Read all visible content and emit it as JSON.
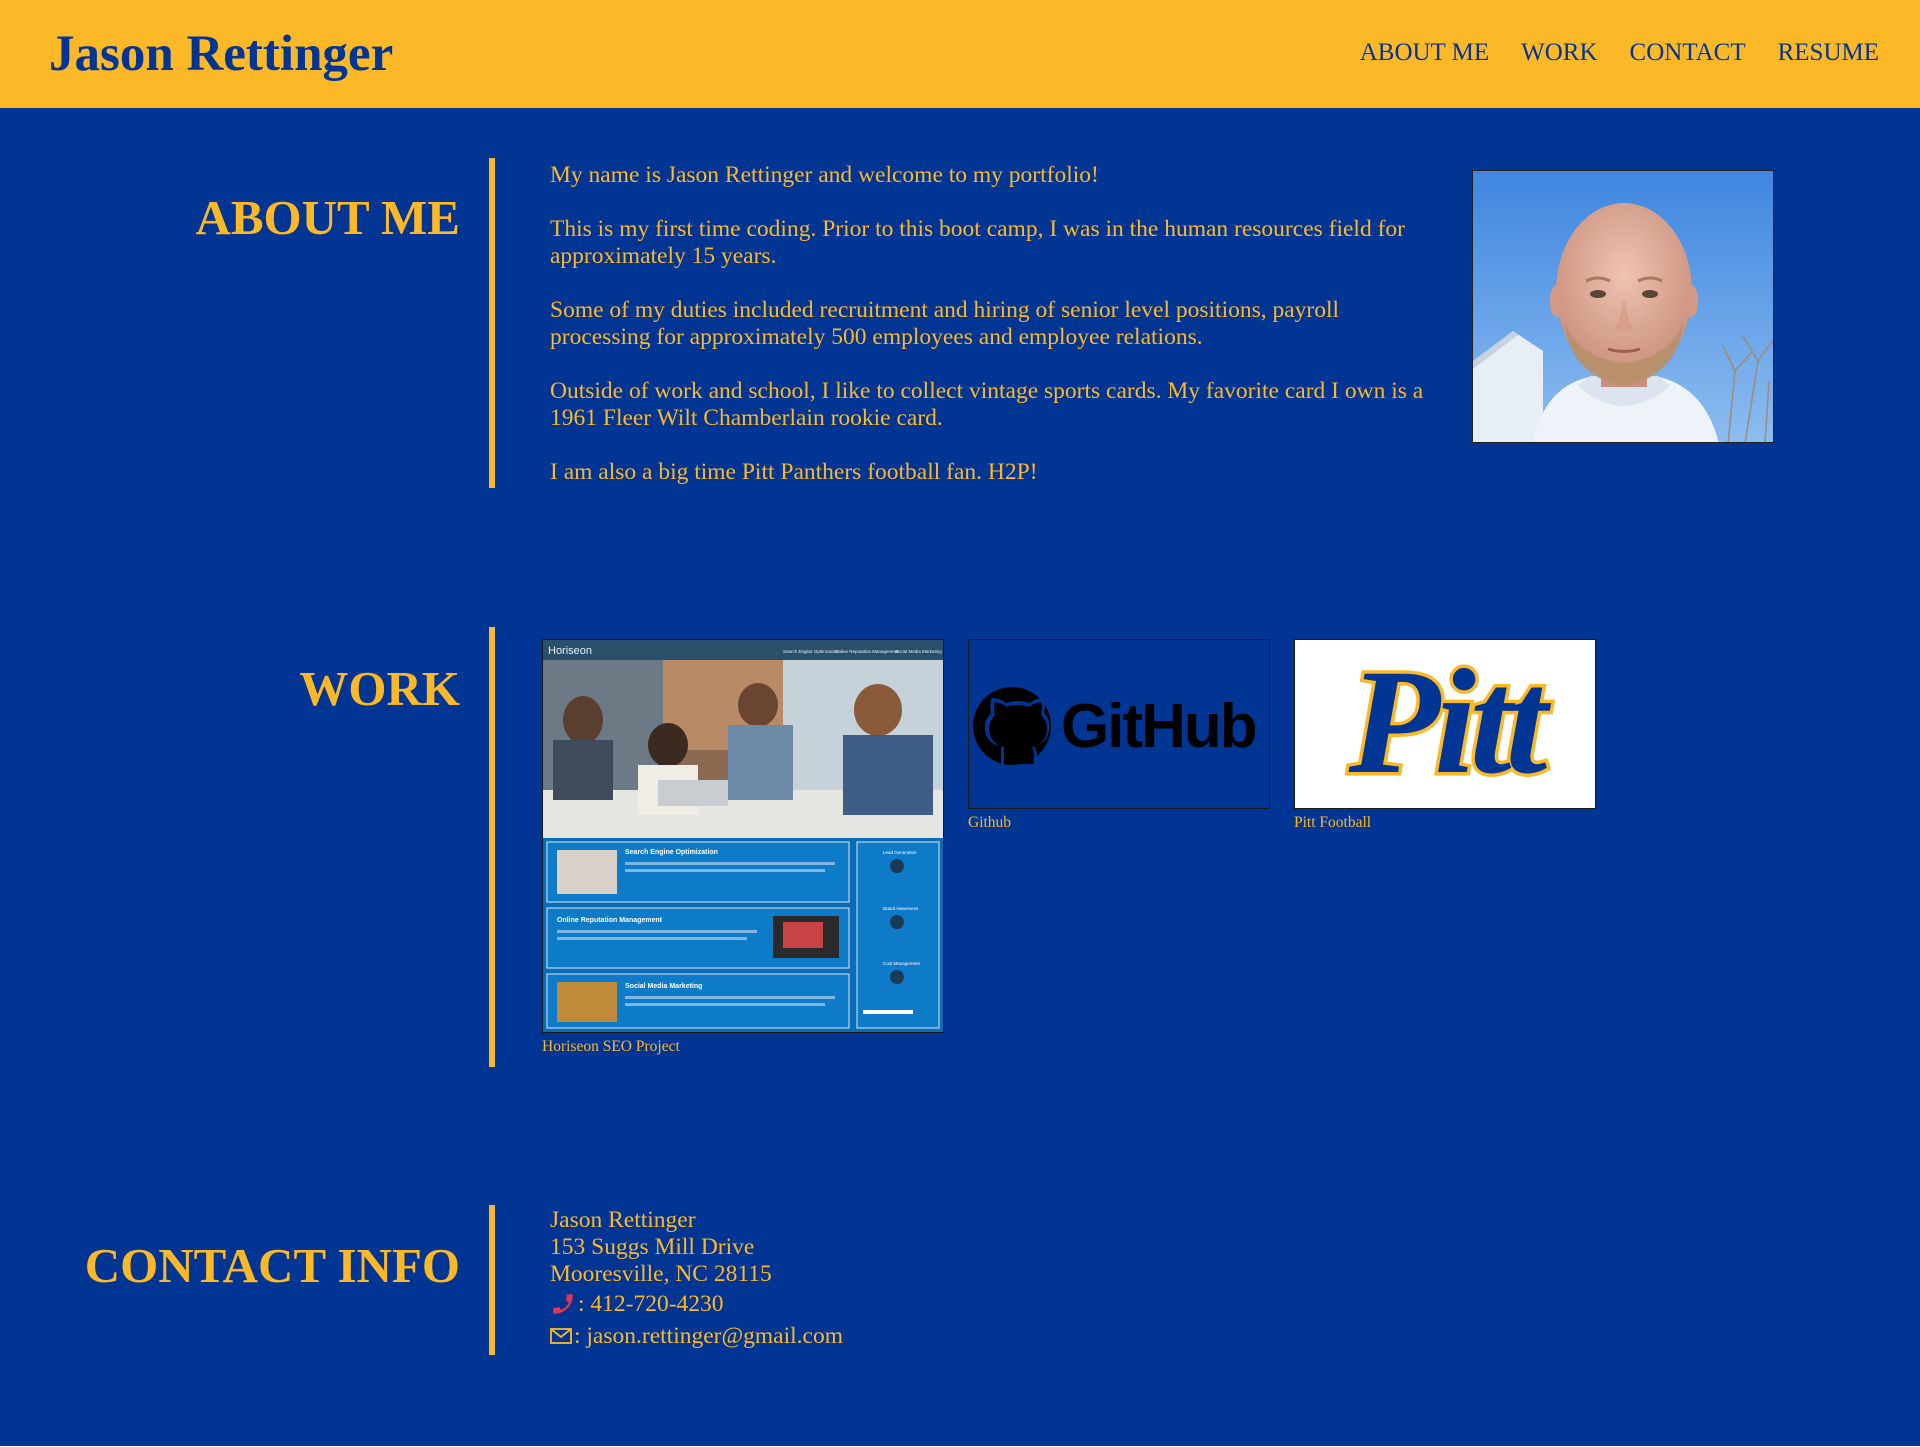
{
  "header": {
    "title": "Jason Rettinger",
    "nav": [
      "ABOUT ME",
      "WORK",
      "CONTACT",
      "RESUME"
    ]
  },
  "about": {
    "heading": "ABOUT ME",
    "paragraphs": [
      "My name is Jason Rettinger and welcome to my portfolio!",
      "This is my first time coding. Prior to this boot camp, I was in the human resources field for approximately 15 years.",
      "Some of my duties included recruitment and hiring of senior level positions, payroll processing for approximately 500 employees and employee relations.",
      "Outside of work and school, I like to collect vintage sports cards. My favorite card I own is a 1961 Fleer Wilt Chamberlain rookie card.",
      "I am also a big time Pitt Panthers football fan. H2P!"
    ]
  },
  "work": {
    "heading": "WORK",
    "items": [
      {
        "caption": "Horiseon SEO Project",
        "preview": {
          "brand": "Horiseon",
          "nav": [
            "Search Engine Optimization",
            "Online Reputation Management",
            "Social Media Marketing"
          ],
          "cards": [
            "Search Engine Optimization",
            "Online Reputation Management",
            "Social Media Marketing"
          ],
          "sidebar": [
            "Lead Generation",
            "Brand Awareness",
            "Cost Management"
          ]
        }
      },
      {
        "caption": "Github",
        "logo_text": "GitHub"
      },
      {
        "caption": "Pitt Football",
        "logo_text": "Pitt"
      }
    ]
  },
  "contact": {
    "heading": "CONTACT INFO",
    "name": "Jason Rettinger",
    "street": "153 Suggs Mill Drive",
    "city": "Mooresville, NC 28115",
    "phone": ": 412-720-4230",
    "email": ": jason.rettinger@gmail.com",
    "phone_icon": "phone-icon",
    "email_icon": "envelope-icon"
  },
  "colors": {
    "gold": "#fdb827",
    "blue": "#003594",
    "phone_red": "#e8344e"
  }
}
